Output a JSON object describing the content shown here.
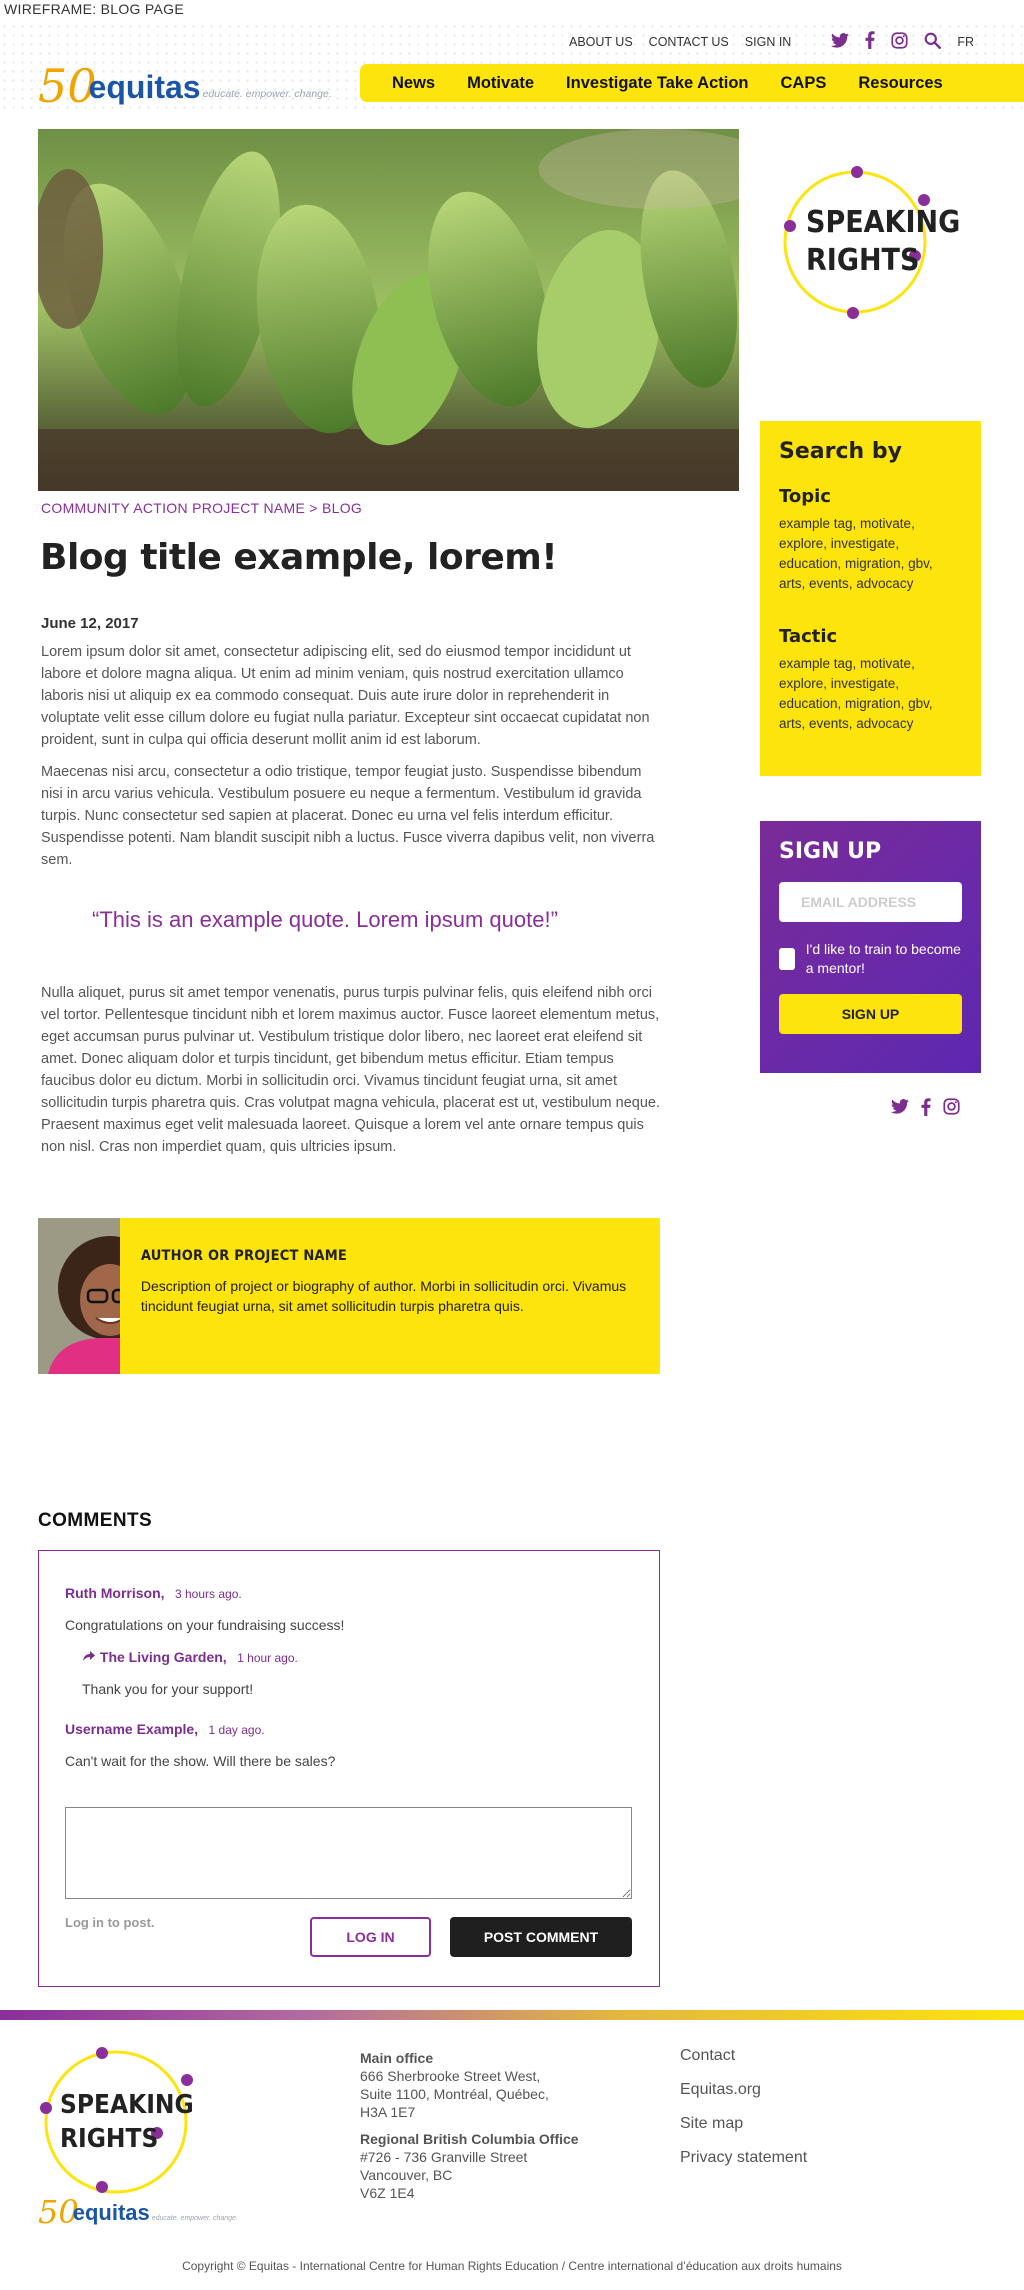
{
  "wireframe_label": "WIREFRAME: BLOG PAGE",
  "topnav": {
    "about": "ABOUT US",
    "contact": "CONTACT US",
    "signin": "SIGN IN",
    "lang": "FR"
  },
  "logo": {
    "number": "50",
    "name": "equitas",
    "tagline": "educate. empower. change."
  },
  "mainnav": [
    "News",
    "Motivate",
    "Investigate Take Action",
    "CAPS",
    "Resources"
  ],
  "breadcrumb": {
    "project": "COMMUNITY ACTION PROJECT NAME",
    "separator": ">",
    "section": "BLOG"
  },
  "post": {
    "title": "Blog title example, lorem!",
    "date": "June 12, 2017",
    "p1": "Lorem ipsum dolor sit amet, consectetur adipiscing elit, sed do eiusmod tempor incididunt ut labore et dolore magna aliqua. Ut enim ad minim veniam, quis nostrud exercitation ullamco laboris nisi ut aliquip ex ea commodo consequat. Duis aute irure dolor in reprehenderit in voluptate velit esse cillum dolore eu fugiat nulla pariatur. Excepteur sint occaecat cupidatat non proident, sunt in culpa qui officia deserunt mollit anim id est laborum.",
    "p2": "Maecenas nisi arcu, consectetur a odio tristique, tempor feugiat justo. Suspendisse bibendum nisi in arcu varius vehicula. Vestibulum posuere eu neque a fermentum. Vestibulum id gravida turpis. Nunc consectetur sed sapien at placerat. Donec eu urna vel felis interdum efficitur. Suspendisse potenti. Nam blandit suscipit nibh a luctus. Fusce viverra dapibus velit, non viverra sem.",
    "quote": "“This is an example quote. Lorem ipsum quote!”",
    "p3": "Nulla aliquet, purus sit amet tempor venenatis, purus turpis pulvinar felis, quis eleifend nibh orci vel tortor. Pellentesque tincidunt nibh et lorem maximus auctor. Fusce laoreet elementum metus, eget accumsan purus pulvinar ut. Vestibulum tristique dolor libero, nec laoreet erat eleifend sit amet. Donec aliquam dolor et turpis tincidunt, get bibendum metus efficitur. Etiam tempus faucibus dolor eu dictum. Morbi in sollicitudin orci. Vivamus tincidunt feugiat urna, sit amet sollicitudin turpis pharetra quis. Cras volutpat magna vehicula, placerat est ut, vestibulum neque. Praesent maximus eget velit malesuada laoreet. Quisque a lorem vel ante ornare tempus quis non nisl. Cras non imperdiet quam, quis ultricies ipsum."
  },
  "author": {
    "name": "AUTHOR OR PROJECT NAME",
    "description": "Description of project or biography of author. Morbi in sollicitudin orci. Vivamus tincidunt feugiat urna, sit amet sollicitudin turpis pharetra quis."
  },
  "comments": {
    "heading": "COMMENTS",
    "items": [
      {
        "author": "Ruth Morrison,",
        "time": "3 hours ago.",
        "text": "Congratulations on your fundraising success!"
      },
      {
        "author": "The Living Garden,",
        "time": "1 hour ago.",
        "text": "Thank you for your support!"
      },
      {
        "author": "Username Example,",
        "time": "1 day ago.",
        "text": "Can't wait for the show. Will there be sales?"
      }
    ],
    "login_note": "Log in to post.",
    "login_button": "LOG IN",
    "post_button": "POST COMMENT"
  },
  "speaking_rights": {
    "line1": "SPEAKING",
    "line2": "RIGHTS"
  },
  "search": {
    "heading": "Search by",
    "topic_label": "Topic",
    "topic_tags": "example tag, motivate, explore, investigate, education, migration, gbv, arts, events, advocacy",
    "tactic_label": "Tactic",
    "tactic_tags": "example tag, motivate, explore, investigate, education, migration, gbv, arts, events, advocacy"
  },
  "signup": {
    "heading": "SIGN UP",
    "email_placeholder": "EMAIL ADDRESS",
    "mentor_label": "I'd like to train to become a mentor!",
    "button": "SIGN UP"
  },
  "footer": {
    "main_office_label": "Main office",
    "main_office_l1": "666 Sherbrooke Street West,",
    "main_office_l2": "Suite 1100, Montréal, Québec,",
    "main_office_l3": "H3A 1E7",
    "bc_office_label": "Regional British Columbia Office",
    "bc_office_l1": "#726 - 736 Granville Street",
    "bc_office_l2": "Vancouver, BC",
    "bc_office_l3": "V6Z 1E4",
    "links": [
      "Contact",
      "Equitas.org",
      "Site map",
      "Privacy statement"
    ],
    "copyright": "Copyright © Equitas - International Centre for Human Rights Education / Centre international d’éducation aux droits humains"
  },
  "colors": {
    "yellow": "#fde40c",
    "purple": "#8a2e9a",
    "blue": "#1a55a8",
    "orange": "#f0a400"
  },
  "icons": [
    "twitter-icon",
    "facebook-icon",
    "instagram-icon",
    "search-icon",
    "reply-arrow-icon"
  ]
}
